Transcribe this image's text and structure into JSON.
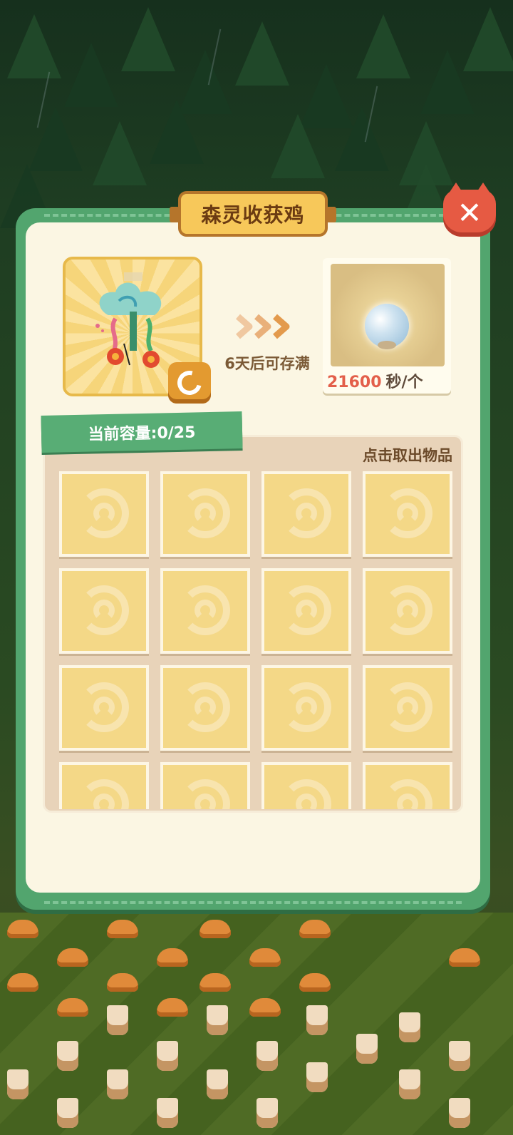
{
  "dialog": {
    "title": "森灵收获鸡",
    "close_icon": "close-icon"
  },
  "producer": {
    "fill_time_text": "6天后可存满",
    "swap_icon": "swap-icon"
  },
  "product": {
    "rate_value": "21600",
    "rate_unit": "秒/个"
  },
  "inventory": {
    "capacity_label": "当前容量:0/25",
    "take_out_hint": "点击取出物品",
    "slots_visible": 16,
    "slot_icon": "swirl-placeholder-icon"
  },
  "colors": {
    "panel_green": "#52a56e",
    "panel_cream": "#fbf6e3",
    "slot_yellow": "#f4d887",
    "rate_red": "#e35f4a",
    "close_red": "#e65a43"
  }
}
